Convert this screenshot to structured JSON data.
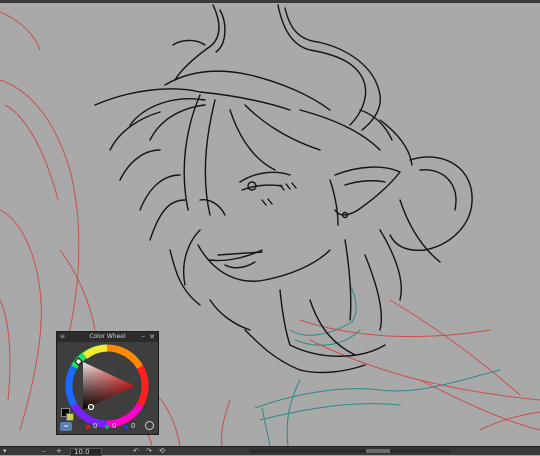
{
  "palette": {
    "title": "Color Wheel",
    "menu_icon": "≡",
    "minimize_icon": "–",
    "close_icon": "✕",
    "main_color": "#000000",
    "sub_color": "#c8d04a",
    "values": [
      "0",
      "0",
      "0"
    ]
  },
  "statusbar": {
    "zoom_value": "10.0",
    "arrow_icon": "▾",
    "minus_icon": "–",
    "plus_icon": "+",
    "rotate_left_icon": "↶",
    "rotate_right_icon": "↷",
    "reset_icon": "⟲"
  },
  "colors": {
    "canvas": "#a9a9a9",
    "lineart": "#141414",
    "sketch_red": "#c9504e",
    "sketch_teal": "#2e8a86"
  }
}
